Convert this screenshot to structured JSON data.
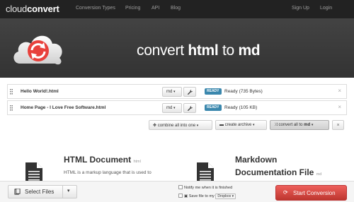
{
  "nav": {
    "brand_light": "cloud",
    "brand_bold": "convert",
    "links": [
      "Conversion Types",
      "Pricing",
      "API",
      "Blog"
    ],
    "sign_up": "Sign Up",
    "login": "Login"
  },
  "hero": {
    "prefix": "convert ",
    "from": "html",
    "middle": " to ",
    "to": "md"
  },
  "files": [
    {
      "name": "Hello World!.html",
      "format": "md",
      "badge": "READY",
      "status": "Ready (735 Bytes)"
    },
    {
      "name": "Home Page - I Love Free Software.html",
      "format": "md",
      "badge": "READY",
      "status": "Ready (105 KB)"
    }
  ],
  "actions": {
    "combine": "combine all into one",
    "archive": "create archive",
    "convert_all_prefix": "convert all to ",
    "convert_all_format": "md"
  },
  "content": {
    "left_title": "HTML Document",
    "left_ext": "html",
    "left_desc": "HTML is a markup language that is used to",
    "right_title_1": "Markdown",
    "right_title_2": "Documentation File",
    "right_ext": "md"
  },
  "bottom": {
    "select_files": "Select Files",
    "notify_label": "Notify me when it is finished",
    "save_label": "Save file to my",
    "save_target": "Dropbox",
    "start": "Start Conversion"
  },
  "colors": {
    "nav_bg": "#222222",
    "hero_bg": "#3a3a3a",
    "ready_badge": "#3a87ad",
    "start_button": "#da4f49",
    "logo_red": "#e8413c"
  }
}
